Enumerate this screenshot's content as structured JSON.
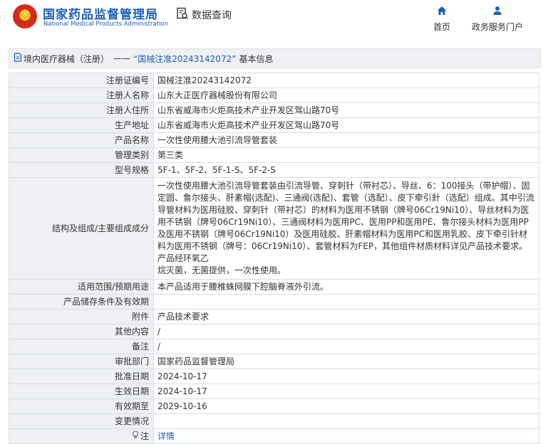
{
  "header": {
    "brand_cn": "国家药品监督管理局",
    "brand_en": "National Medical Products Administration",
    "data_query": "数据查询",
    "nav": [
      {
        "label": "首页",
        "icon": "home-icon"
      },
      {
        "label": "政务服务门户",
        "icon": "user-icon"
      }
    ],
    "brand_color": "#1f5fb8"
  },
  "title_bar": {
    "category": "境内医疗器械（注册）",
    "separator": "——",
    "registration": "“国械注准20243142072”",
    "suffix": "基本信息"
  },
  "rows": [
    {
      "label": "注册证编号",
      "value": "国械注准20243142072"
    },
    {
      "label": "注册人名称",
      "value": "山东大正医疗器械股份有限公司"
    },
    {
      "label": "注册人住所",
      "value": "山东省威海市火炬高技术产业开发区驾山路70号"
    },
    {
      "label": "生产地址",
      "value": "山东省威海市火炬高技术产业开发区驾山路70号"
    },
    {
      "label": "产品名称",
      "value": "一次性使用腰大池引流导管套装"
    },
    {
      "label": "管理类别",
      "value": "第三类"
    },
    {
      "label": "型号规格",
      "value": "5F-1、5F-2、5F-1-S、5F-2-S"
    },
    {
      "label": "结构及组成/主要组成成分",
      "value": "一次性使用腰大池引流导管套装由引流导管、穿刺针（带衬芯）、导丝、6：100接头（带护帽）、固定圆、鲁尔接头、肝素帽(选配)、三通阀(选配)、套管（选配）、皮下牵引針（选配）组成。其中引流导管材料为医用硅胶、穿刺针（带衬芯）的材料为医用不锈钢（牌号06Cr19Ni10）、导丝材料为医用不锈钢（牌号06Cr19Ni10）、三通阀材料为医用PC、医用PP和医用PE、鲁尔接头材料为医用PP及医用不锈钢（牌号06Cr19Ni10）及医用硅胶、肝素帽材料为医用PC和医用乳胶、皮下牵引针材料为医用不锈钢（牌号：06Cr19Ni10）、套管材料为FEP，其他组件材质材料详见产品技术要求。产品经环氧乙\n烷灭菌，无菌提供，一次性使用。"
    },
    {
      "label": "适用范围/预期用途",
      "value": "本产品适用于腰椎蛛网膜下腔脑脊液外引流。"
    },
    {
      "label": "产品储存条件及有效期",
      "value": ""
    },
    {
      "label": "附件",
      "value": "产品技术要求"
    },
    {
      "label": "其他内容",
      "value": "/"
    },
    {
      "label": "备注",
      "value": "/"
    },
    {
      "label": "审批部门",
      "value": "国家药品监督管理局"
    },
    {
      "label": "批准日期",
      "value": "2024-10-17"
    },
    {
      "label": "生效日期",
      "value": "2024-10-17"
    },
    {
      "label": "有效期至",
      "value": "2029-10-16"
    },
    {
      "label": "变更情况",
      "value": ""
    }
  ],
  "note_row": {
    "label": "注",
    "icon": "lightbulb-icon",
    "link": "详情"
  }
}
